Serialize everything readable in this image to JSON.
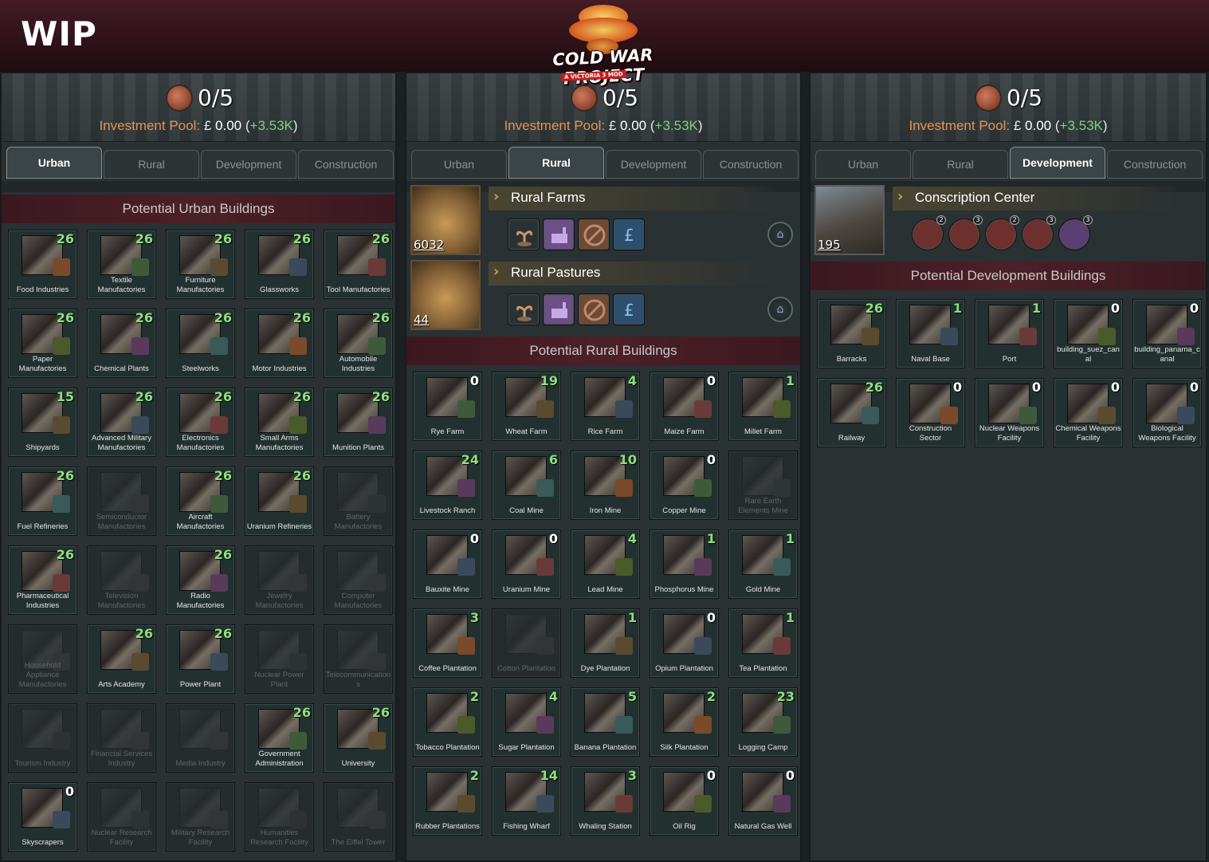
{
  "wip_label": "WIP",
  "logo": {
    "title": "COLD WAR PROJECT",
    "subtitle": "A VICTORIA 3 MOD"
  },
  "panels": [
    {
      "ratio": "0/5",
      "inv_label": "Investment Pool:",
      "inv_currency": "£",
      "inv_value": "0.00",
      "inv_paren_open": "(",
      "inv_delta": "+3.53K",
      "inv_paren_close": ")",
      "tabs": [
        "Urban",
        "Rural",
        "Development",
        "Construction"
      ],
      "active_tab": "Urban",
      "section_title": "Potential Urban Buildings",
      "buildings": [
        {
          "name": "Food Industries",
          "count": "26",
          "enabled": true
        },
        {
          "name": "Textile Manufactories",
          "count": "26",
          "enabled": true
        },
        {
          "name": "Furniture Manufactories",
          "count": "26",
          "enabled": true
        },
        {
          "name": "Glassworks",
          "count": "26",
          "enabled": true
        },
        {
          "name": "Tool Manufactories",
          "count": "26",
          "enabled": true
        },
        {
          "name": "Paper Manufactories",
          "count": "26",
          "enabled": true
        },
        {
          "name": "Chemical Plants",
          "count": "26",
          "enabled": true
        },
        {
          "name": "Steelworks",
          "count": "26",
          "enabled": true
        },
        {
          "name": "Motor Industries",
          "count": "26",
          "enabled": true
        },
        {
          "name": "Automobile Industries",
          "count": "26",
          "enabled": true
        },
        {
          "name": "Shipyards",
          "count": "15",
          "enabled": true
        },
        {
          "name": "Advanced Military Manufactories",
          "count": "26",
          "enabled": true
        },
        {
          "name": "Electronics Manufactories",
          "count": "26",
          "enabled": true
        },
        {
          "name": "Small Arms Manufactories",
          "count": "26",
          "enabled": true
        },
        {
          "name": "Munition Plants",
          "count": "26",
          "enabled": true
        },
        {
          "name": "Fuel Refineries",
          "count": "26",
          "enabled": true
        },
        {
          "name": "Semiconductor Manufactories",
          "count": "",
          "enabled": false
        },
        {
          "name": "Aircraft Manufactories",
          "count": "26",
          "enabled": true
        },
        {
          "name": "Uranium Refineries",
          "count": "26",
          "enabled": true
        },
        {
          "name": "Battery Manufactories",
          "count": "",
          "enabled": false
        },
        {
          "name": "Pharmaceutical Industries",
          "count": "26",
          "enabled": true
        },
        {
          "name": "Television Manufactories",
          "count": "",
          "enabled": false
        },
        {
          "name": "Radio Manufactories",
          "count": "26",
          "enabled": true
        },
        {
          "name": "Jewelry Manufactories",
          "count": "",
          "enabled": false
        },
        {
          "name": "Computer Manufactories",
          "count": "",
          "enabled": false
        },
        {
          "name": "Household Appliance Manufactories",
          "count": "",
          "enabled": false
        },
        {
          "name": "Arts Academy",
          "count": "26",
          "enabled": true
        },
        {
          "name": "Power Plant",
          "count": "26",
          "enabled": true
        },
        {
          "name": "Nuclear Power Plant",
          "count": "",
          "enabled": false
        },
        {
          "name": "Telecommunications",
          "count": "",
          "enabled": false
        },
        {
          "name": "Tourism Industry",
          "count": "",
          "enabled": false
        },
        {
          "name": "Financial Services Industry",
          "count": "",
          "enabled": false
        },
        {
          "name": "Media Industry",
          "count": "",
          "enabled": false
        },
        {
          "name": "Government Administration",
          "count": "26",
          "enabled": true
        },
        {
          "name": "University",
          "count": "26",
          "enabled": true
        },
        {
          "name": "Skyscrapers",
          "count": "0",
          "enabled": true
        },
        {
          "name": "Nuclear Research Facility",
          "count": "",
          "enabled": false
        },
        {
          "name": "Military Research Facility",
          "count": "",
          "enabled": false
        },
        {
          "name": "Humanities Research Facility",
          "count": "",
          "enabled": false
        },
        {
          "name": "The Eiffel Tower",
          "count": "",
          "enabled": false
        }
      ]
    },
    {
      "ratio": "0/5",
      "inv_label": "Investment Pool:",
      "inv_currency": "£",
      "inv_value": "0.00",
      "inv_paren_open": "(",
      "inv_delta": "+3.53K",
      "inv_paren_close": ")",
      "tabs": [
        "Urban",
        "Rural",
        "Development",
        "Construction"
      ],
      "active_tab": "Rural",
      "groups": [
        {
          "title": "Rural Farms",
          "count": "6032"
        },
        {
          "title": "Rural Pastures",
          "count": "44"
        }
      ],
      "group_icons": [
        "sprout-icon",
        "factory-icon",
        "no-plow-icon",
        "pound-hand-icon"
      ],
      "section_title": "Potential Rural Buildings",
      "buildings": [
        {
          "name": "Rye Farm",
          "count": "0",
          "enabled": true
        },
        {
          "name": "Wheat Farm",
          "count": "19",
          "enabled": true
        },
        {
          "name": "Rice Farm",
          "count": "4",
          "enabled": true
        },
        {
          "name": "Maize Farm",
          "count": "0",
          "enabled": true
        },
        {
          "name": "Millet Farm",
          "count": "1",
          "enabled": true
        },
        {
          "name": "Livestock Ranch",
          "count": "24",
          "enabled": true
        },
        {
          "name": "Coal Mine",
          "count": "6",
          "enabled": true
        },
        {
          "name": "Iron Mine",
          "count": "10",
          "enabled": true
        },
        {
          "name": "Copper Mine",
          "count": "0",
          "enabled": true
        },
        {
          "name": "Rare Earth Elements Mine",
          "count": "",
          "enabled": false
        },
        {
          "name": "Bauxite Mine",
          "count": "0",
          "enabled": true
        },
        {
          "name": "Uranium Mine",
          "count": "0",
          "enabled": true
        },
        {
          "name": "Lead Mine",
          "count": "4",
          "enabled": true
        },
        {
          "name": "Phosphorus Mine",
          "count": "1",
          "enabled": true
        },
        {
          "name": "Gold Mine",
          "count": "1",
          "enabled": true
        },
        {
          "name": "Coffee Plantation",
          "count": "3",
          "enabled": true
        },
        {
          "name": "Cotton Plantation",
          "count": "",
          "enabled": false
        },
        {
          "name": "Dye Plantation",
          "count": "1",
          "enabled": true
        },
        {
          "name": "Opium Plantation",
          "count": "0",
          "enabled": true
        },
        {
          "name": "Tea Plantation",
          "count": "1",
          "enabled": true
        },
        {
          "name": "Tobacco Plantation",
          "count": "2",
          "enabled": true
        },
        {
          "name": "Sugar Plantation",
          "count": "4",
          "enabled": true
        },
        {
          "name": "Banana Plantation",
          "count": "5",
          "enabled": true
        },
        {
          "name": "Silk Plantation",
          "count": "2",
          "enabled": true
        },
        {
          "name": "Logging Camp",
          "count": "23",
          "enabled": true
        },
        {
          "name": "Rubber Plantations",
          "count": "2",
          "enabled": true
        },
        {
          "name": "Fishing Wharf",
          "count": "14",
          "enabled": true
        },
        {
          "name": "Whaling Station",
          "count": "3",
          "enabled": true
        },
        {
          "name": "Oil Rig",
          "count": "0",
          "enabled": true
        },
        {
          "name": "Natural Gas Well",
          "count": "0",
          "enabled": true
        }
      ]
    },
    {
      "ratio": "0/5",
      "inv_label": "Investment Pool:",
      "inv_currency": "£",
      "inv_value": "0.00",
      "inv_paren_open": "(",
      "inv_delta": "+3.53K",
      "inv_paren_close": ")",
      "tabs": [
        "Urban",
        "Rural",
        "Development",
        "Construction"
      ],
      "active_tab": "Development",
      "groups": [
        {
          "title": "Conscription Center",
          "count": "195"
        }
      ],
      "group_icons": [
        {
          "icon": "infantry-icon",
          "badge": "2"
        },
        {
          "icon": "no-infantry-icon",
          "badge": "3"
        },
        {
          "icon": "cavalry-icon",
          "badge": "2"
        },
        {
          "icon": "artillery-icon",
          "badge": "3"
        },
        {
          "icon": "chemical-icon",
          "badge": "3"
        }
      ],
      "section_title": "Potential Development Buildings",
      "buildings": [
        {
          "name": "Barracks",
          "count": "26",
          "enabled": true
        },
        {
          "name": "Naval Base",
          "count": "1",
          "enabled": true
        },
        {
          "name": "Port",
          "count": "1",
          "enabled": true
        },
        {
          "name": "building_suez_canal",
          "count": "0",
          "enabled": true
        },
        {
          "name": "building_panama_canal",
          "count": "0",
          "enabled": true
        },
        {
          "name": "Railway",
          "count": "26",
          "enabled": true
        },
        {
          "name": "Construction Sector",
          "count": "0",
          "enabled": true
        },
        {
          "name": "Nuclear Weapons Facility",
          "count": "0",
          "enabled": true
        },
        {
          "name": "Chemical Weapons Facility",
          "count": "0",
          "enabled": true
        },
        {
          "name": "Biological Weapons Facility",
          "count": "0",
          "enabled": true
        }
      ]
    }
  ],
  "colors": {
    "accent_green": "#8ee07e",
    "investment_label": "#e39450",
    "header_band": "#4c2028"
  }
}
